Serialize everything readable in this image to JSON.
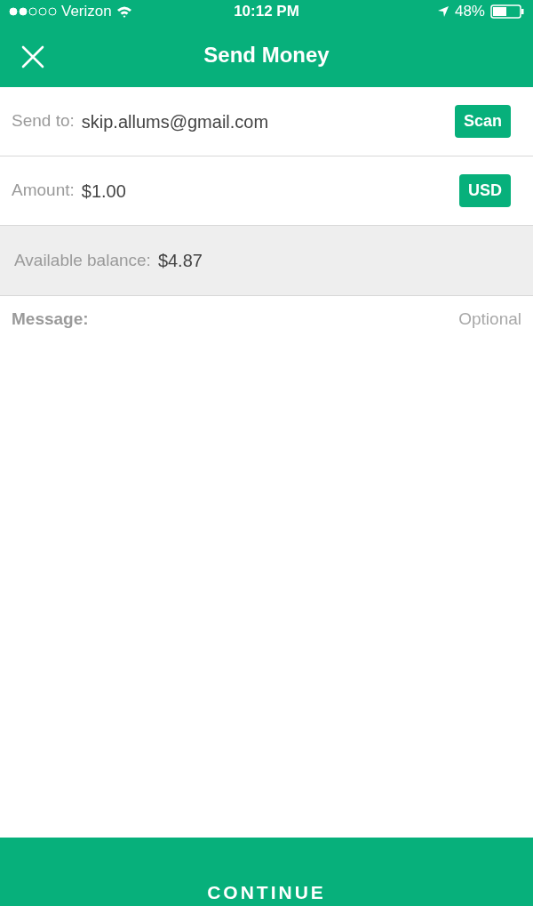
{
  "status_bar": {
    "carrier": "Verizon",
    "time": "10:12 PM",
    "battery": "48%"
  },
  "nav": {
    "title": "Send Money"
  },
  "fields": [
    {
      "label": "Send to:",
      "value": "skip.allums@gmail.com",
      "button": "Scan"
    },
    {
      "label": "Amount:",
      "value": "$1.00",
      "button": "USD"
    }
  ],
  "balance": {
    "label": "Available balance:",
    "value": "$4.87"
  },
  "message": {
    "label": "Message:",
    "placeholder": "Optional"
  },
  "continue_button": "CONTINUE"
}
